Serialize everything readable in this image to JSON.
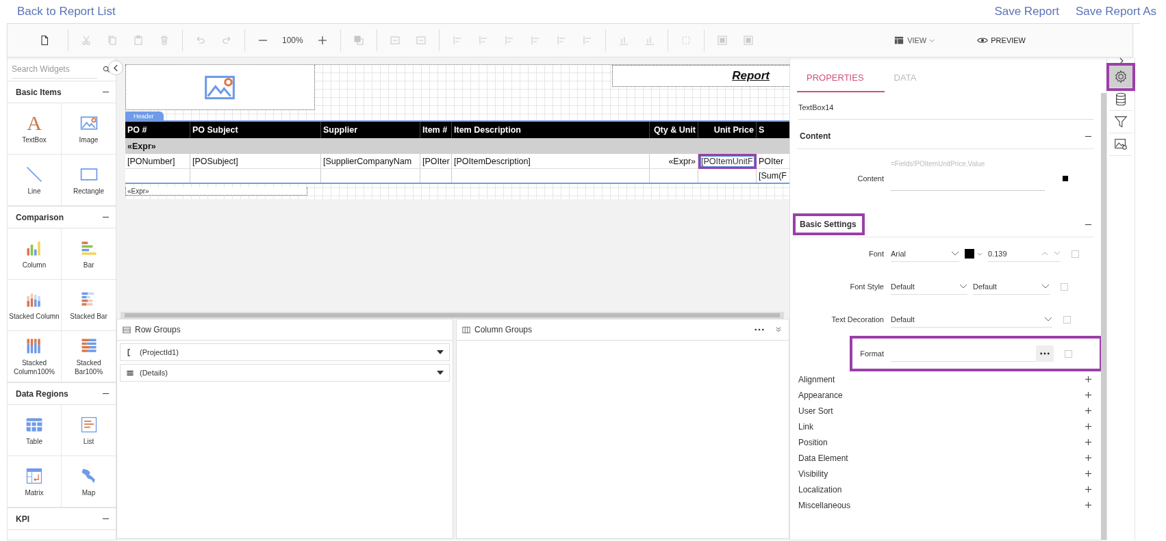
{
  "top_bar": {
    "back_link": "Back to Report List",
    "actions": [
      "Save Report",
      "Save Report As"
    ]
  },
  "toolbar": {
    "groups": [
      [
        {
          "kind": "new",
          "disabled": false
        }
      ],
      [
        {
          "kind": "cut",
          "disabled": true
        },
        {
          "kind": "copy",
          "disabled": true
        },
        {
          "kind": "paste",
          "disabled": true
        },
        {
          "kind": "delete",
          "disabled": true
        }
      ],
      [
        {
          "kind": "undo",
          "disabled": true
        },
        {
          "kind": "redo",
          "disabled": true
        }
      ],
      [
        {
          "kind": "zoom-out",
          "disabled": false
        },
        {
          "kind": "zoom-level",
          "label": "100%"
        },
        {
          "kind": "zoom-in",
          "disabled": false
        }
      ],
      [
        {
          "kind": "order",
          "disabled": true
        }
      ],
      [
        {
          "kind": "insert",
          "disabled": true
        },
        {
          "kind": "insert",
          "disabled": true
        }
      ],
      [
        {
          "kind": "align",
          "disabled": true
        },
        {
          "kind": "align",
          "disabled": true
        },
        {
          "kind": "align",
          "disabled": true
        },
        {
          "kind": "align",
          "disabled": true
        },
        {
          "kind": "align",
          "disabled": true
        },
        {
          "kind": "align",
          "disabled": true
        }
      ],
      [
        {
          "kind": "distribute",
          "disabled": true
        },
        {
          "kind": "distribute",
          "disabled": true
        }
      ],
      [
        {
          "kind": "size",
          "disabled": true
        }
      ],
      [
        {
          "kind": "center",
          "disabled": true
        },
        {
          "kind": "center",
          "disabled": true
        }
      ]
    ],
    "view": "VIEW",
    "preview": "PREVIEW"
  },
  "widgets": {
    "search_placeholder": "Search Widgets",
    "sections": [
      {
        "title": "Basic Items",
        "expanded": true,
        "items": [
          {
            "label": "TextBox",
            "kind": "textbox",
            "glyph": "A"
          },
          {
            "label": "Image",
            "kind": "image"
          },
          {
            "label": "Line",
            "kind": "line"
          },
          {
            "label": "Rectangle",
            "kind": "rectangle"
          }
        ]
      },
      {
        "title": "Comparison",
        "expanded": true,
        "items": [
          {
            "label": "Column",
            "kind": "column"
          },
          {
            "label": "Bar",
            "kind": "bar"
          },
          {
            "label": "Stacked Column",
            "kind": "stacked-column"
          },
          {
            "label": "Stacked Bar",
            "kind": "stacked-bar"
          },
          {
            "label": "Stacked Column100%",
            "kind": "stacked-column-100"
          },
          {
            "label": "Stacked Bar100%",
            "kind": "stacked-bar-100"
          }
        ]
      },
      {
        "title": "Data Regions",
        "expanded": true,
        "items": [
          {
            "label": "Table",
            "kind": "table"
          },
          {
            "label": "List",
            "kind": "list"
          },
          {
            "label": "Matrix",
            "kind": "matrix"
          },
          {
            "label": "Map",
            "kind": "map"
          }
        ]
      },
      {
        "title": "KPI",
        "expanded": true
      }
    ]
  },
  "report": {
    "title": "Report",
    "header_tab": "Header",
    "columns": [
      "PO #",
      "PO Subject",
      "Supplier",
      "Item #",
      "Item Description",
      "Qty & Unit",
      "Unit Price",
      "S"
    ],
    "group_row": "«Expr»",
    "detail_row": [
      {
        "text": "[PONumber]",
        "selected": false
      },
      {
        "text": "[POSubject]",
        "selected": false
      },
      {
        "text": "[SupplierCompanyNam",
        "selected": false
      },
      {
        "text": "[POIter",
        "selected": false
      },
      {
        "text": "[POItemDescription]",
        "selected": false
      },
      {
        "text": "«Expr»",
        "selected": false
      },
      {
        "text": "[POItemUnitF",
        "selected": true
      },
      {
        "text": "POIter",
        "selected": false
      }
    ],
    "total_last_cell": "[Sum(F",
    "footer_expr": "«Expr»"
  },
  "groups": {
    "row_groups": {
      "title": "Row Groups",
      "items": [
        {
          "label": "(ProjectId1)",
          "kind": "group"
        },
        {
          "label": "(Details)",
          "kind": "details"
        }
      ]
    },
    "column_groups": {
      "title": "Column Groups"
    }
  },
  "properties": {
    "tabs": [
      {
        "label": "PROPERTIES",
        "selected": true
      },
      {
        "label": "DATA",
        "selected": false
      }
    ],
    "name_value": "TextBox14",
    "sections": [
      {
        "title": "Content",
        "expanded": true,
        "highlighted": false,
        "rows": [
          {
            "kind": "expression",
            "label": "Content",
            "value": "=Fields!POItemUnitPrice.Value"
          }
        ]
      },
      {
        "title": "Basic Settings",
        "expanded": true,
        "highlighted": true,
        "rows": [
          {
            "kind": "font",
            "label": "Font",
            "value": "Arial",
            "color": "#000000",
            "size": "0.139",
            "checked": false
          },
          {
            "kind": "two-select",
            "label": "Font Style",
            "values": [
              "Default",
              "Default"
            ],
            "checked": false
          },
          {
            "kind": "select",
            "label": "Text Decoration",
            "value": "Default",
            "checked": false
          },
          {
            "kind": "format",
            "label": "Format",
            "highlighted": true,
            "checked": false
          }
        ]
      },
      {
        "title": "Alignment",
        "expanded": false,
        "highlighted": false
      },
      {
        "title": "Appearance",
        "expanded": false,
        "highlighted": false
      },
      {
        "title": "User Sort",
        "expanded": false,
        "highlighted": false
      },
      {
        "title": "Link",
        "expanded": false,
        "highlighted": false
      },
      {
        "title": "Position",
        "expanded": false,
        "highlighted": false
      },
      {
        "title": "Data Element",
        "expanded": false,
        "highlighted": false
      },
      {
        "title": "Visibility",
        "expanded": false,
        "highlighted": false
      },
      {
        "title": "Localization",
        "expanded": false,
        "highlighted": false
      },
      {
        "title": "Miscellaneous",
        "expanded": false,
        "highlighted": false
      }
    ]
  },
  "side_icons": [
    {
      "kind": "settings",
      "selected": true,
      "highlighted": true
    },
    {
      "kind": "database",
      "selected": false,
      "highlighted": false
    },
    {
      "kind": "filter",
      "selected": false,
      "highlighted": false
    },
    {
      "kind": "image-settings",
      "selected": false,
      "highlighted": false
    }
  ]
}
